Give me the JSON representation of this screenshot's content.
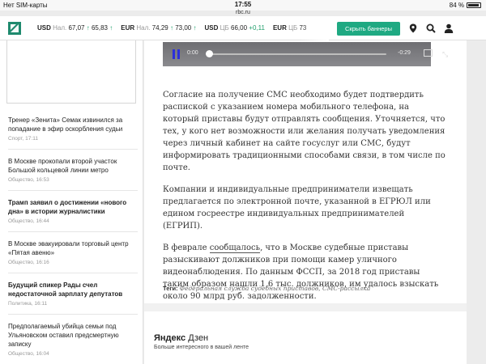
{
  "status_bar": {
    "carrier": "Нет SIM-карты",
    "time": "17:55",
    "battery": "84 %",
    "url": "rbc.ru"
  },
  "header": {
    "rates": [
      {
        "cur": "USD",
        "label": "Нал.",
        "buy": "67,07",
        "sell": "65,83"
      },
      {
        "cur": "EUR",
        "label": "Нал.",
        "buy": "74,29",
        "sell": "73,00"
      },
      {
        "cur": "USD",
        "label": "ЦБ",
        "buy": "66,00",
        "sell": "+0,11"
      },
      {
        "cur": "EUR",
        "label": "ЦБ",
        "buy": "73",
        "sell": ""
      }
    ],
    "hide_banners_label": "Скрыть баннеры"
  },
  "sidebar": {
    "news": [
      {
        "title": "Тренер «Зенита» Семак извинился за попадание в эфир оскорбления судьи",
        "meta": "Спорт, 17:11",
        "bold": false
      },
      {
        "title": "В Москве прокопали второй участок Большой кольцевой линии метро",
        "meta": "Общество, 16:53",
        "bold": false
      },
      {
        "title": "Трамп заявил о достижении «нового дна» в истории журналистики",
        "meta": "Общество, 16:44",
        "bold": true
      },
      {
        "title": "В Москве эвакуировали торговый центр «Пятая авеню»",
        "meta": "Общество, 16:16",
        "bold": false
      },
      {
        "title": "Будущий спикер Рады счел недостаточной зарплату депутатов",
        "meta": "Политика, 16:11",
        "bold": true
      },
      {
        "title": "Предполагаемый убийца семьи под Ульяновском оставил предсмертную записку",
        "meta": "Общество, 16:04",
        "bold": false
      }
    ]
  },
  "player": {
    "current": "0:00",
    "remaining": "-0:29"
  },
  "article": {
    "p1": "Согласие на получение СМС необходимо будет подтвердить распиской с указанием номера мобильного телефона, на который приставы будут отправлять сообщения. Уточняется, что тех, у кого нет возможности или желания получать уведомления через личный кабинет на сайте госуслуг или СМС, будут информировать традиционными способами связи, в том числе по почте.",
    "p2": "Компании и индивидуальные предприниматели извещать предлагается по электронной почте, указанной в ЕГРЮЛ или едином госреестре индивидуальных предпринимателей (ЕГРИП).",
    "p3_pre": "В феврале ",
    "p3_link": "сообщалось",
    "p3_post": ", что в Москве судебные приставы разыскивают должников при помощи камер уличного видеонаблюдения. По данным ФССП, за 2018 год приставы таким образом нашли 1,6 тыс. должников, им удалось взыскать около 90 млрд руб. задолженности.",
    "tags_label": "Теги:",
    "tags": "Федеральная служба судебных приставов, СМС-рассылка"
  },
  "zen": {
    "brand": "Яндекс",
    "product": "Дзен",
    "subtitle": "Больше интересного в вашей ленте"
  }
}
